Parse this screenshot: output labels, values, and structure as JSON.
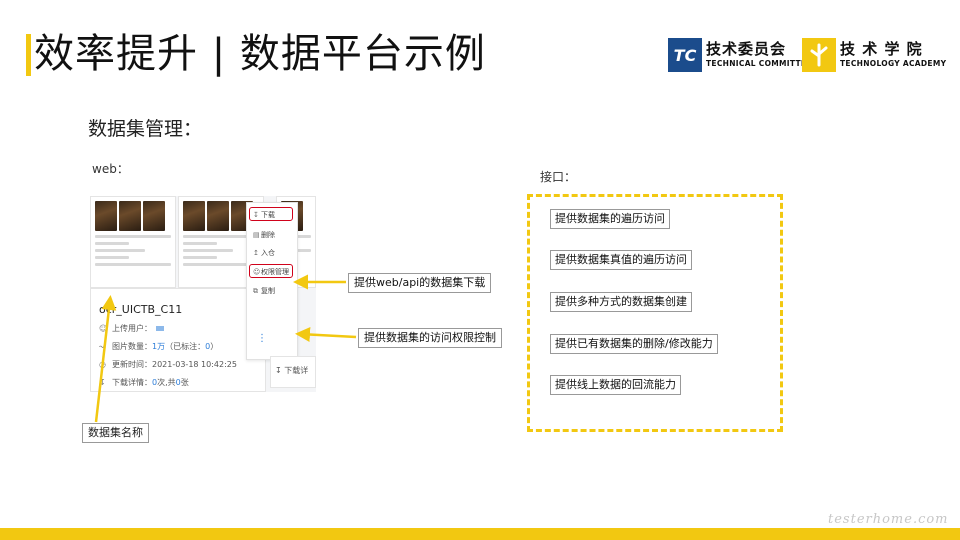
{
  "header": {
    "title": "效率提升 | 数据平台示例",
    "logo_tc": {
      "mark": "TC",
      "cn": "技术委员会",
      "en": "TECHNICAL COMMITTEE"
    },
    "logo_ta": {
      "cn": "技 术 学 院",
      "en": "TECHNOLOGY ACADEMY"
    }
  },
  "section_title": "数据集管理：",
  "web_label": "web：",
  "api_label": "接口：",
  "screenshot": {
    "dataset_name": "ocr_UICTB_C11",
    "uploader_label": "上传用户：",
    "image_count_label": "图片数量：",
    "image_count_value": "1万",
    "labeled_text": "（已标注：",
    "labeled_value": "0",
    "labeled_close": "）",
    "updated_label": "更新时间：",
    "updated_value": "2021-03-18 10:42:25",
    "download_label": "下载详情：",
    "download_count": "0",
    "download_mid": "次,共",
    "download_total": "0",
    "download_unit": "张",
    "menu": [
      "下载",
      "删除",
      "入仓",
      "权限管理",
      "复制"
    ],
    "right_card_text": "下载详"
  },
  "callouts": {
    "download": "提供web/api的数据集下载",
    "permission": "提供数据集的访问权限控制",
    "dataset_name": "数据集名称"
  },
  "api_items": [
    "提供数据集的遍历访问",
    "提供数据集真值的遍历访问",
    "提供多种方式的数据集创建",
    "提供已有数据集的删除/修改能力",
    "提供线上数据的回流能力"
  ],
  "watermark": "testerhome.com",
  "colors": {
    "accent": "#f2c811",
    "brand_blue": "#1b4c8c",
    "highlight_red": "#d0021b"
  }
}
